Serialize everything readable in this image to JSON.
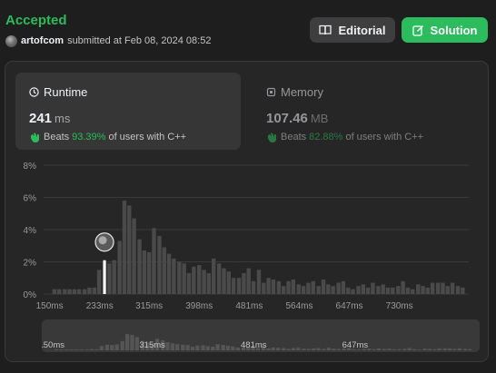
{
  "submission": {
    "status": "Accepted",
    "username": "artofcom",
    "submitted_text": "submitted at Feb 08, 2024 08:52"
  },
  "buttons": {
    "editorial": "Editorial",
    "solution": "Solution"
  },
  "metrics": {
    "runtime": {
      "title": "Runtime",
      "value": "241",
      "unit": "ms",
      "beats_label": "Beats",
      "beats_pct": "93.39%",
      "beats_suffix": "of users with C++",
      "icon": "clock-icon"
    },
    "memory": {
      "title": "Memory",
      "value": "107.46",
      "unit": "MB",
      "beats_label": "Beats",
      "beats_pct": "82.88%",
      "beats_suffix": "of users with C++",
      "icon": "chip-icon"
    }
  },
  "colors": {
    "accent_green": "#2cbb5d",
    "bar": "#4a4a4a",
    "selected_bar": "#ffffff"
  },
  "chart_data": {
    "type": "bar",
    "title": "",
    "xlabel": "",
    "ylabel": "",
    "x_range": [
      140,
      845
    ],
    "ylim": [
      0,
      8
    ],
    "y_ticks": [
      "0%",
      "2%",
      "4%",
      "6%",
      "8%"
    ],
    "x_ticks": [
      "150ms",
      "233ms",
      "315ms",
      "398ms",
      "481ms",
      "564ms",
      "647ms",
      "730ms"
    ],
    "x_tick_values": [
      150,
      233,
      315,
      398,
      481,
      564,
      647,
      730
    ],
    "x": [
      158,
      166,
      175,
      183,
      191,
      199,
      208,
      216,
      224,
      232,
      241,
      249,
      257,
      266,
      274,
      282,
      290,
      299,
      307,
      315,
      323,
      332,
      340,
      348,
      356,
      365,
      373,
      381,
      389,
      398,
      406,
      414,
      422,
      431,
      439,
      447,
      455,
      464,
      472,
      480,
      488,
      497,
      505,
      513,
      521,
      530,
      538,
      546,
      554,
      563,
      571,
      579,
      587,
      596,
      604,
      612,
      620,
      629,
      637,
      645,
      653,
      662,
      670,
      678,
      686,
      695,
      703,
      711,
      719,
      728,
      736,
      744,
      752,
      761,
      769,
      777,
      785,
      794,
      802,
      810,
      818,
      827,
      835
    ],
    "values": [
      0.3,
      0.3,
      0.3,
      0.3,
      0.3,
      0.3,
      0.3,
      0.4,
      0.4,
      1.5,
      2.0,
      1.9,
      2.1,
      3.3,
      5.8,
      5.5,
      4.7,
      3.4,
      2.7,
      2.6,
      4.1,
      3.6,
      2.9,
      2.5,
      2.2,
      2.0,
      1.9,
      1.3,
      1.7,
      1.8,
      1.5,
      1.3,
      2.2,
      1.9,
      1.6,
      1.4,
      1.0,
      1.0,
      1.3,
      1.6,
      0.8,
      1.5,
      0.7,
      1.0,
      0.9,
      0.8,
      0.5,
      0.8,
      0.9,
      0.6,
      0.5,
      0.7,
      0.8,
      0.5,
      0.9,
      0.6,
      0.5,
      0.7,
      0.8,
      0.4,
      0.3,
      0.5,
      0.6,
      0.4,
      0.7,
      0.5,
      0.6,
      0.4,
      0.4,
      0.5,
      0.8,
      0.4,
      0.3,
      0.6,
      0.5,
      0.4,
      0.7,
      0.7,
      0.7,
      0.5,
      0.7,
      0.5,
      0.4
    ],
    "selected_x": 241,
    "selected_value": 2.1,
    "grid": true,
    "navigator": {
      "x_ticks": [
        "150ms",
        "315ms",
        "481ms",
        "647ms"
      ]
    }
  }
}
